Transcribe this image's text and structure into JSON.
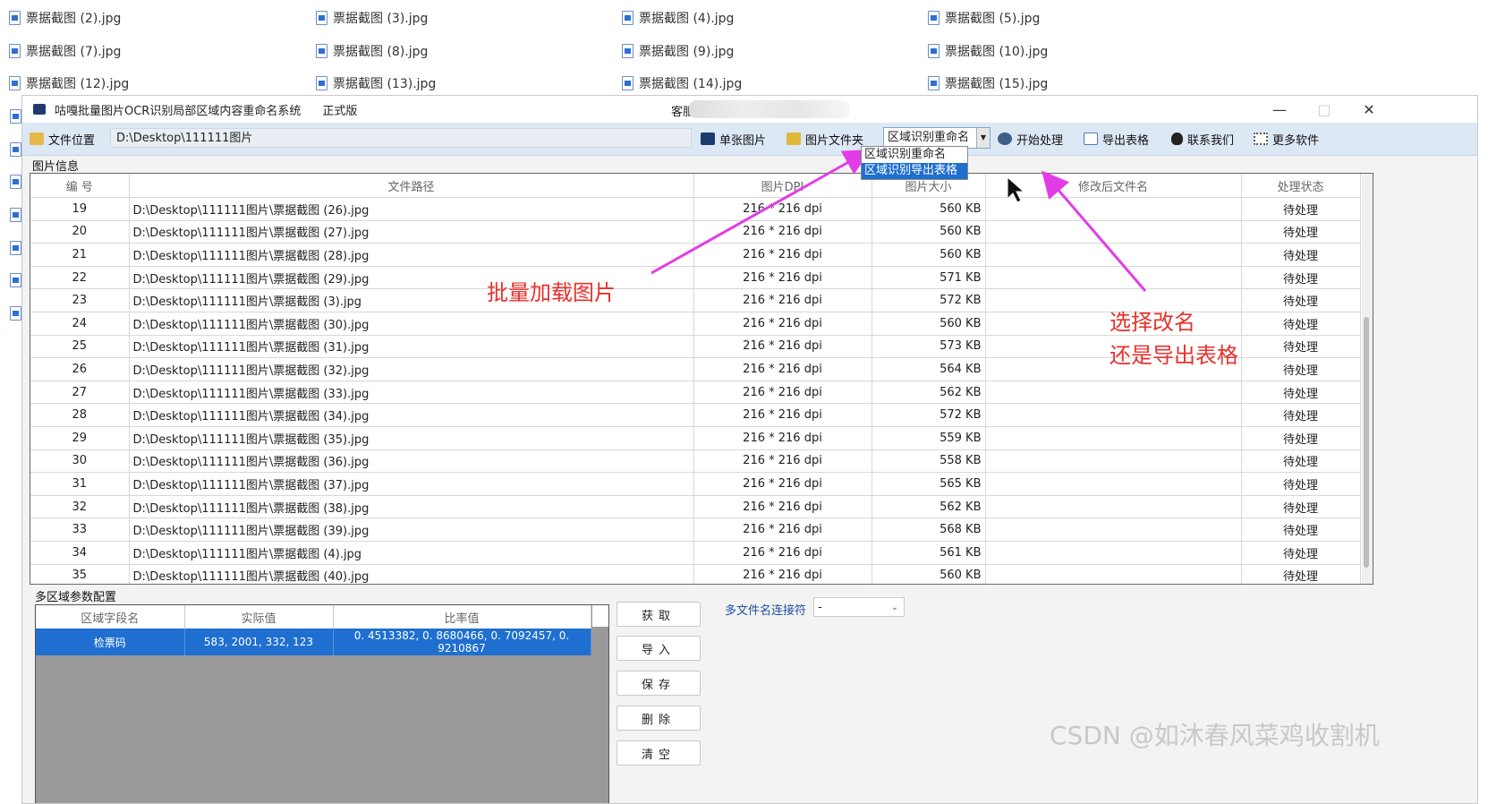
{
  "explorer": {
    "files": [
      "票据截图 (2).jpg",
      "票据截图 (3).jpg",
      "票据截图 (4).jpg",
      "票据截图 (5).jpg",
      "票据截图 (7).jpg",
      "票据截图 (8).jpg",
      "票据截图 (9).jpg",
      "票据截图 (10).jpg",
      "票据截图 (12).jpg",
      "票据截图 (13).jpg",
      "票据截图 (14).jpg",
      "票据截图 (15).jpg"
    ]
  },
  "window": {
    "title": "咕嘎批量图片OCR识别局部区域内容重命名系统",
    "edition": "正式版",
    "customer_label": "客服",
    "minimize": "—",
    "maximize": "□",
    "close": "✕"
  },
  "toolbar": {
    "file_location": "文件位置",
    "path": "D:\\Desktop\\111111图片",
    "single_image": "单张图片",
    "image_folder": "图片文件夹",
    "mode_selected": "区域识别重命名",
    "mode_options": [
      "区域识别重命名",
      "区域识别导出表格"
    ],
    "start": "开始处理",
    "export": "导出表格",
    "contact": "联系我们",
    "more": "更多软件"
  },
  "image_info": {
    "section_label": "图片信息",
    "columns": [
      "编 号",
      "文件路径",
      "图片DPI",
      "图片大小",
      "修改后文件名",
      "处理状态"
    ],
    "rows": [
      [
        "19",
        "D:\\Desktop\\111111图片\\票据截图 (26).jpg",
        "216 * 216 dpi",
        "560 KB",
        "",
        "待处理"
      ],
      [
        "20",
        "D:\\Desktop\\111111图片\\票据截图 (27).jpg",
        "216 * 216 dpi",
        "560 KB",
        "",
        "待处理"
      ],
      [
        "21",
        "D:\\Desktop\\111111图片\\票据截图 (28).jpg",
        "216 * 216 dpi",
        "560 KB",
        "",
        "待处理"
      ],
      [
        "22",
        "D:\\Desktop\\111111图片\\票据截图 (29).jpg",
        "216 * 216 dpi",
        "571 KB",
        "",
        "待处理"
      ],
      [
        "23",
        "D:\\Desktop\\111111图片\\票据截图 (3).jpg",
        "216 * 216 dpi",
        "572 KB",
        "",
        "待处理"
      ],
      [
        "24",
        "D:\\Desktop\\111111图片\\票据截图 (30).jpg",
        "216 * 216 dpi",
        "560 KB",
        "",
        "待处理"
      ],
      [
        "25",
        "D:\\Desktop\\111111图片\\票据截图 (31).jpg",
        "216 * 216 dpi",
        "573 KB",
        "",
        "待处理"
      ],
      [
        "26",
        "D:\\Desktop\\111111图片\\票据截图 (32).jpg",
        "216 * 216 dpi",
        "564 KB",
        "",
        "待处理"
      ],
      [
        "27",
        "D:\\Desktop\\111111图片\\票据截图 (33).jpg",
        "216 * 216 dpi",
        "562 KB",
        "",
        "待处理"
      ],
      [
        "28",
        "D:\\Desktop\\111111图片\\票据截图 (34).jpg",
        "216 * 216 dpi",
        "572 KB",
        "",
        "待处理"
      ],
      [
        "29",
        "D:\\Desktop\\111111图片\\票据截图 (35).jpg",
        "216 * 216 dpi",
        "559 KB",
        "",
        "待处理"
      ],
      [
        "30",
        "D:\\Desktop\\111111图片\\票据截图 (36).jpg",
        "216 * 216 dpi",
        "558 KB",
        "",
        "待处理"
      ],
      [
        "31",
        "D:\\Desktop\\111111图片\\票据截图 (37).jpg",
        "216 * 216 dpi",
        "565 KB",
        "",
        "待处理"
      ],
      [
        "32",
        "D:\\Desktop\\111111图片\\票据截图 (38).jpg",
        "216 * 216 dpi",
        "562 KB",
        "",
        "待处理"
      ],
      [
        "33",
        "D:\\Desktop\\111111图片\\票据截图 (39).jpg",
        "216 * 216 dpi",
        "568 KB",
        "",
        "待处理"
      ],
      [
        "34",
        "D:\\Desktop\\111111图片\\票据截图 (4).jpg",
        "216 * 216 dpi",
        "561 KB",
        "",
        "待处理"
      ],
      [
        "35",
        "D:\\Desktop\\111111图片\\票据截图 (40).jpg",
        "216 * 216 dpi",
        "560 KB",
        "",
        "待处理"
      ]
    ]
  },
  "region_config": {
    "section_label": "多区域参数配置",
    "columns": [
      "区域字段名",
      "实际值",
      "比率值"
    ],
    "rows": [
      [
        "检票码",
        "583, 2001, 332, 123",
        "0. 4513382, 0. 8680466, 0. 7092457, 0. 9210867"
      ]
    ],
    "buttons": [
      "获取",
      "导入",
      "保存",
      "删除",
      "清空"
    ],
    "joiner_label": "多文件名连接符",
    "joiner_value": "-"
  },
  "annotations": {
    "batch_load": "批量加载图片",
    "choose_line1": "选择改名",
    "choose_line2": "还是导出表格"
  },
  "watermark": "CSDN @如沐春风菜鸡收割机",
  "colors": {
    "accent": "#1f6fd0",
    "annotation": "#e8312c",
    "arrow": "#e23ce6"
  }
}
